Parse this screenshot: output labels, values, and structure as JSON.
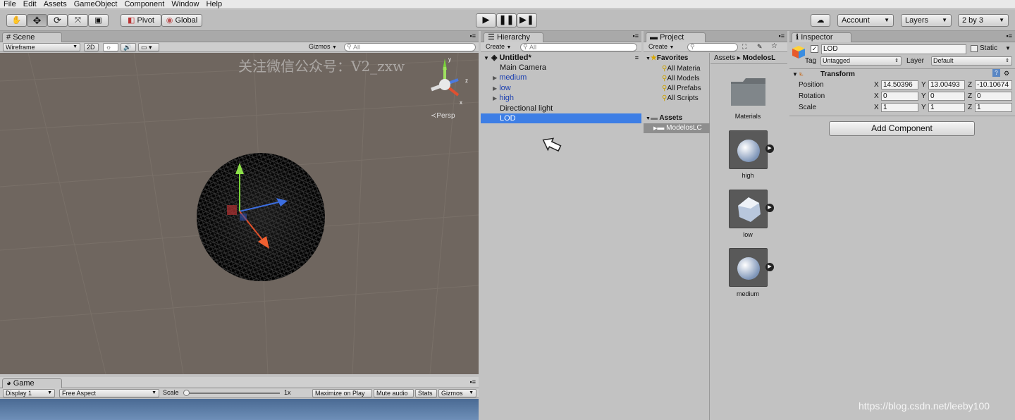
{
  "menu": [
    "File",
    "Edit",
    "Assets",
    "GameObject",
    "Component",
    "Window",
    "Help"
  ],
  "toolbar": {
    "pivot": "Pivot",
    "global": "Global",
    "account": "Account",
    "layers": "Layers",
    "layout": "2 by 3"
  },
  "scene": {
    "tab": "Scene",
    "shading": "Wireframe",
    "mode_2d": "2D",
    "gizmos": "Gizmos",
    "search_placeholder": "All",
    "persp": "Persp",
    "watermark": "关注微信公众号：V2_zxw"
  },
  "game": {
    "tab": "Game",
    "display": "Display 1",
    "aspect": "Free Aspect",
    "scale_label": "Scale",
    "scale_value": "1x",
    "maximize": "Maximize on Play",
    "mute": "Mute audio",
    "stats": "Stats",
    "gizmos": "Gizmos"
  },
  "hierarchy": {
    "tab": "Hierarchy",
    "create": "Create",
    "search_placeholder": "All",
    "scene_name": "Untitled*",
    "items": [
      {
        "label": "Main Camera",
        "prefab": false,
        "expandable": false
      },
      {
        "label": "medium",
        "prefab": true,
        "expandable": true
      },
      {
        "label": "low",
        "prefab": true,
        "expandable": true
      },
      {
        "label": "high",
        "prefab": true,
        "expandable": true
      },
      {
        "label": "Directional light",
        "prefab": false,
        "expandable": false
      },
      {
        "label": "LOD",
        "prefab": false,
        "expandable": false,
        "selected": true
      }
    ]
  },
  "project": {
    "tab": "Project",
    "create": "Create",
    "favorites_label": "Favorites",
    "favorites": [
      "All Materia",
      "All Models",
      "All Prefabs",
      "All Scripts"
    ],
    "assets_label": "Assets",
    "assets_child": "ModelosLC",
    "breadcrumb_root": "Assets",
    "breadcrumb_sep": "▸",
    "breadcrumb_folder": "ModelosL",
    "thumbs": [
      "Materials",
      "high",
      "low",
      "medium"
    ]
  },
  "inspector": {
    "tab": "Inspector",
    "object_name": "LOD",
    "static_label": "Static",
    "tag_label": "Tag",
    "tag_value": "Untagged",
    "layer_label": "Layer",
    "layer_value": "Default",
    "component": "Transform",
    "position_label": "Position",
    "rotation_label": "Rotation",
    "scale_label": "Scale",
    "axis": [
      "X",
      "Y",
      "Z"
    ],
    "position": [
      "14.50396",
      "13.00493",
      "-10.10674"
    ],
    "rotation": [
      "0",
      "0",
      "0"
    ],
    "scale": [
      "1",
      "1",
      "1"
    ],
    "add_component": "Add Component"
  },
  "footer_watermark": "https://blog.csdn.net/leeby100",
  "colors": {
    "selection": "#3d7ee5",
    "prefab_text": "#1b3fb0",
    "scene_bg": "#6f665f"
  }
}
